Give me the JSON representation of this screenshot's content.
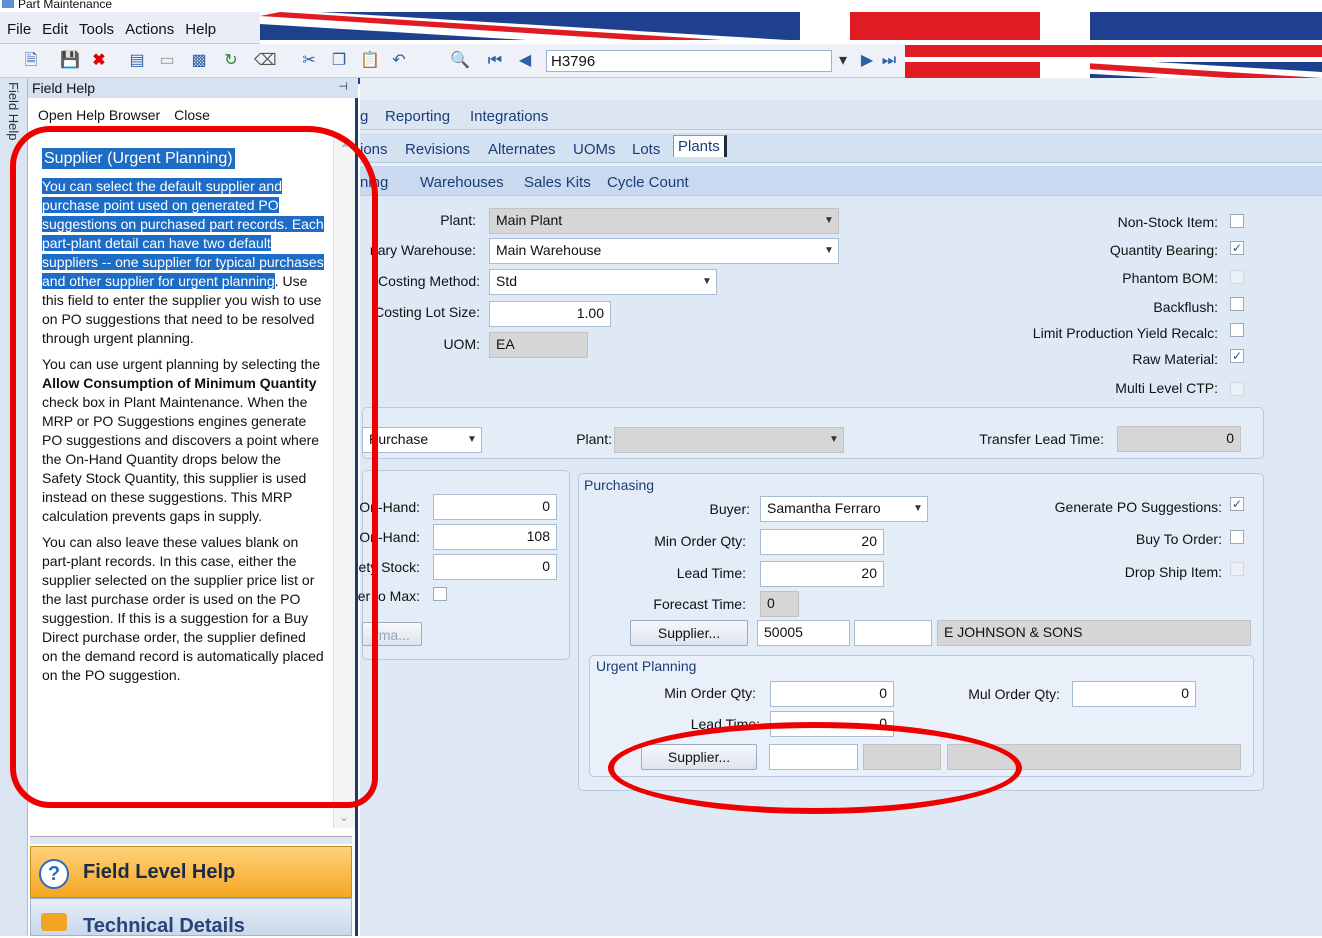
{
  "window": {
    "title": "Part Maintenance"
  },
  "menu": {
    "items": [
      "File",
      "Edit",
      "Tools",
      "Actions",
      "Help"
    ]
  },
  "toolbar": {
    "part_number": "H3796"
  },
  "helppanel": {
    "strip_label": "Field Help",
    "title": "Field Help",
    "open_browser": "Open Help Browser",
    "close": "Close",
    "heading": "Supplier (Urgent Planning)",
    "para1_selected": "You can select the default supplier and purchase point used on generated PO suggestions on purchased part records. Each part-plant detail can have two default suppliers -- one supplier for typical purchases and other supplier for urgent planning",
    "para1_rest": ". Use this field to enter the supplier you wish to use on PO suggestions that need to be resolved through urgent planning.",
    "para2_a": "You can use urgent planning by selecting the ",
    "para2_b": "Allow Consumption of Minimum Quantity",
    "para2_c": " check box in Plant Maintenance. When the MRP or PO Suggestions engines generate PO suggestions and discovers a point where the On-Hand Quantity drops below the Safety Stock Quantity, this supplier is used instead on these suggestions. This MRP calculation prevents gaps in supply.",
    "para3": "You can also leave these values blank on part-plant records. In this case, either the supplier selected on the supplier price list or the last purchase order is used on the PO suggestion. If this is a suggestion for a Buy Direct purchase order, the supplier defined on the demand record is automatically placed on the PO suggestion.",
    "btn_field_help": "Field Level Help",
    "btn_technical": "Technical Details"
  },
  "tabs": {
    "row1": [
      "g",
      "Reporting",
      "Integrations"
    ],
    "row2": [
      "ions",
      "Revisions",
      "Alternates",
      "UOMs",
      "Lots",
      "Plants"
    ],
    "row3": [
      "ning",
      "Warehouses",
      "Sales Kits",
      "Cycle Count"
    ]
  },
  "form": {
    "plant_label": "Plant:",
    "plant_value": "Main Plant",
    "warehouse_label": "nary Warehouse:",
    "warehouse_value": "Main Warehouse",
    "costing_label": "Costing Method:",
    "costing_value": "Std",
    "lotsize_label": "Costing Lot Size:",
    "lotsize_value": "1.00",
    "uom_label": "UOM:",
    "uom_value": "EA",
    "nonstock_label": "Non-Stock Item:",
    "qtybearing_label": "Quantity Bearing:",
    "phantom_label": "Phantom BOM:",
    "backflush_label": "Backflush:",
    "limitprod_label": "Limit Production Yield Recalc:",
    "rawmat_label": "Raw Material:",
    "multictp_label": "Multi Level CTP:",
    "type_value": "Purchase",
    "plant2_label": "Plant:",
    "transfer_label": "Transfer Lead Time:",
    "transfer_value": "0",
    "onhand_min_label": "On-Hand:",
    "onhand_min_value": "0",
    "onhand_max_label": "On-Hand:",
    "onhand_max_value": "108",
    "safety_label": "ety Stock:",
    "safety_value": "0",
    "tomax_label": "er to Max:",
    "disabled_btn": "rma...",
    "purchasing_title": "Purchasing",
    "buyer_label": "Buyer:",
    "buyer_value": "Samantha Ferraro",
    "minorder_label": "Min Order Qty:",
    "minorder_value": "20",
    "leadtime_label": "Lead Time:",
    "leadtime_value": "20",
    "forecast_label": "Forecast Time:",
    "forecast_value": "0",
    "supplier_btn": "Supplier...",
    "supplier_id": "50005",
    "supplier_name": "E JOHNSON & SONS",
    "genpo_label": "Generate PO Suggestions:",
    "buyto_label": "Buy To Order:",
    "dropship_label": "Drop Ship Item:",
    "urgent_title": "Urgent Planning",
    "u_minorder_label": "Min Order Qty:",
    "u_minorder_value": "0",
    "u_mulorder_label": "Mul Order Qty:",
    "u_mulorder_value": "0",
    "u_leadtime_label": "Lead Time:",
    "u_leadtime_value": "0",
    "u_supplier_btn": "Supplier..."
  },
  "colors": {
    "annotation": "#e00000",
    "accent": "#1d6cc6"
  }
}
